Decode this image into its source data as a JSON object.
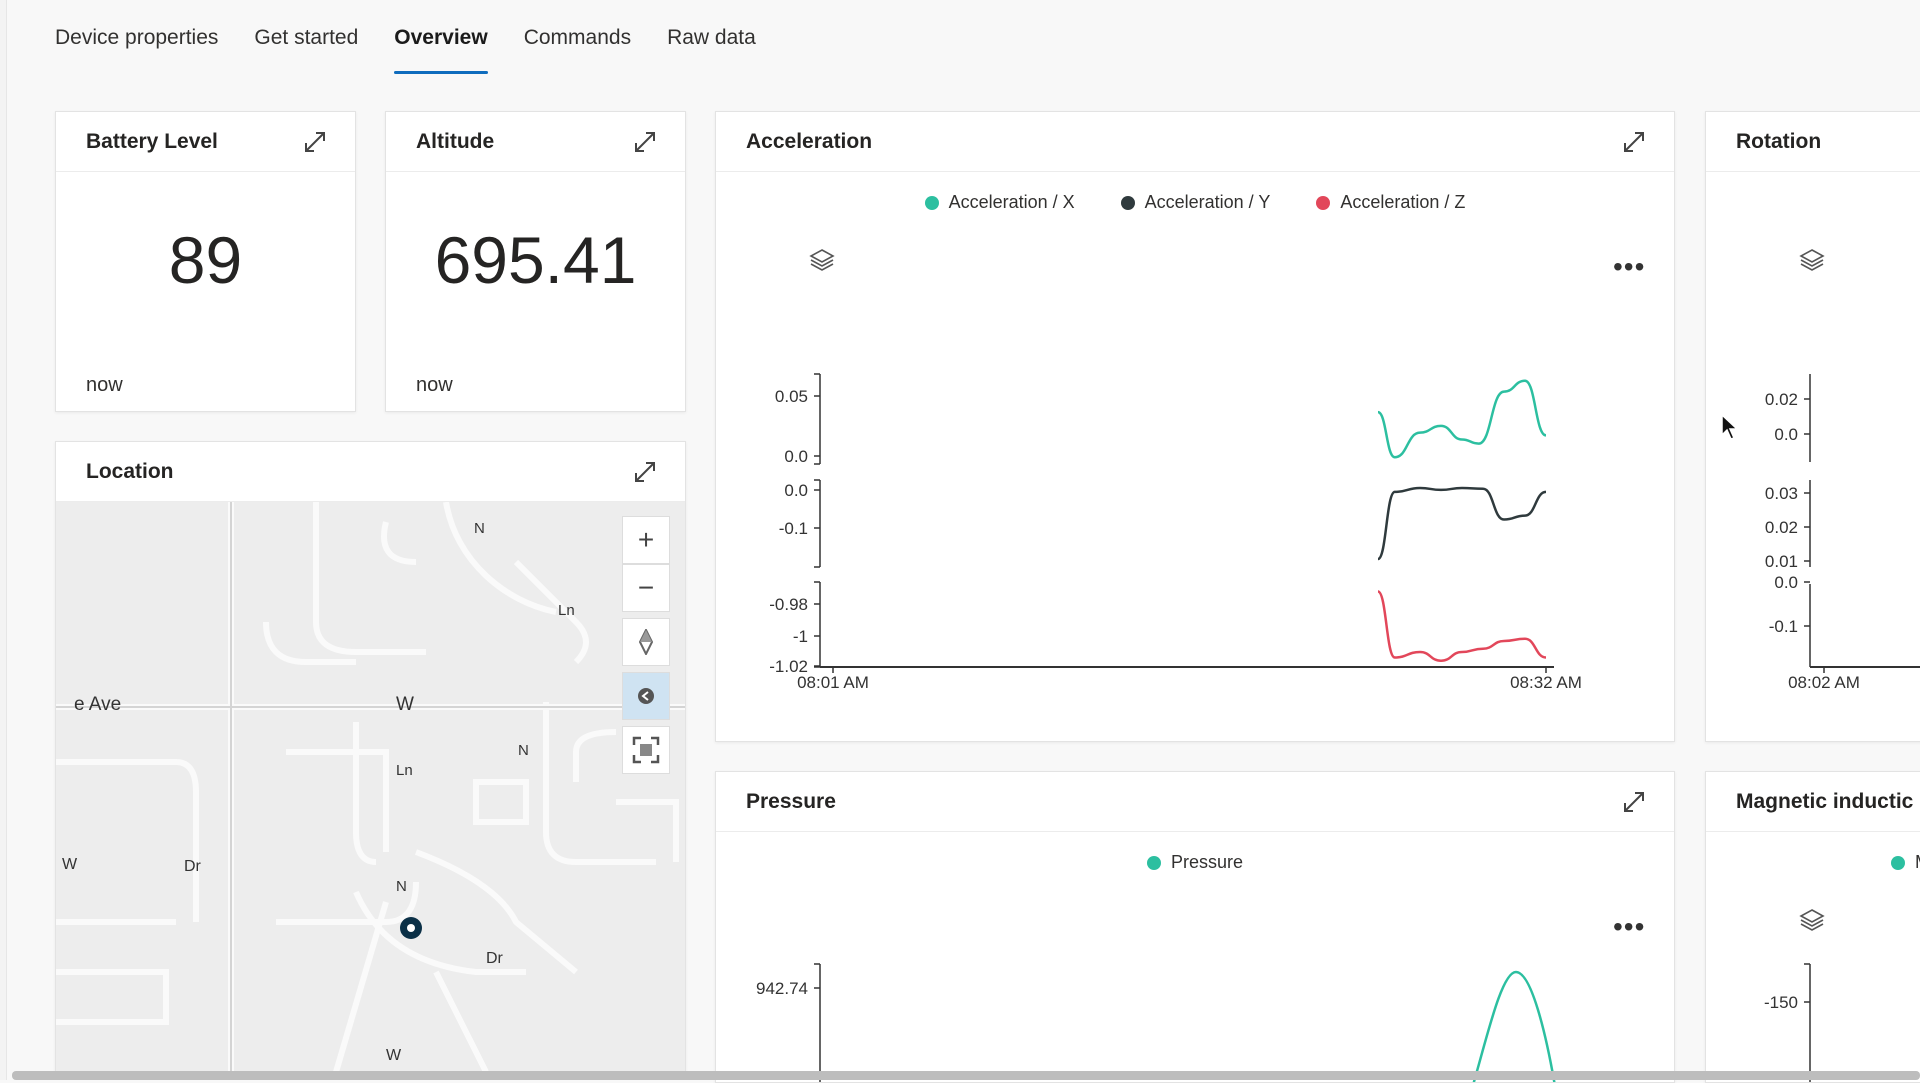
{
  "tabs": [
    {
      "label": "Device properties"
    },
    {
      "label": "Get started"
    },
    {
      "label": "Overview"
    },
    {
      "label": "Commands"
    },
    {
      "label": "Raw data"
    }
  ],
  "active_tab": "Overview",
  "battery": {
    "title": "Battery Level",
    "value": "89",
    "time": "now"
  },
  "altitude": {
    "title": "Altitude",
    "value": "695.41",
    "time": "now"
  },
  "location": {
    "title": "Location",
    "labels": {
      "ave": "e Ave",
      "w_road": "W",
      "w_dr": "W",
      "dr_left": "Dr",
      "dr_bottom": "Dr",
      "w_bottom": "W",
      "n1": "N",
      "n2": "N",
      "n3": "N",
      "ln": "Ln",
      "ln2": "Ln"
    },
    "controls": {
      "zoom_in": "+",
      "zoom_out": "−"
    }
  },
  "acceleration": {
    "title": "Acceleration",
    "legend": [
      {
        "name": "Acceleration / X",
        "color": "#2cbfa0"
      },
      {
        "name": "Acceleration / Y",
        "color": "#2f3a3d"
      },
      {
        "name": "Acceleration / Z",
        "color": "#e2475a"
      }
    ],
    "more": "•••"
  },
  "rotation": {
    "title": "Rotation"
  },
  "pressure": {
    "title": "Pressure",
    "legend": [
      {
        "name": "Pressure",
        "color": "#2cbfa0"
      }
    ],
    "more": "•••"
  },
  "magnetic": {
    "title": "Magnetic inductic",
    "legend_partial": "M"
  },
  "chart_data": [
    {
      "type": "line",
      "title": "Acceleration",
      "x_ticks": [
        "08:01 AM",
        "08:32 AM"
      ],
      "panels": [
        {
          "series": "Acceleration / X",
          "color": "#2cbfa0",
          "y_ticks": [
            "0.05",
            "0.0"
          ],
          "ylim": [
            0.0,
            0.06
          ],
          "x": [
            0,
            0.2,
            0.5,
            0.75,
            1.0,
            1.2,
            1.5,
            1.75,
            2.0
          ],
          "y": [
            0.035,
            0.002,
            0.02,
            0.025,
            0.015,
            0.012,
            0.05,
            0.058,
            0.018
          ]
        },
        {
          "series": "Acceleration / Y",
          "color": "#2f3a3d",
          "y_ticks": [
            "0.0",
            "-0.1"
          ],
          "ylim": [
            -0.18,
            0.02
          ],
          "x": [
            0,
            0.2,
            0.5,
            0.75,
            1.0,
            1.25,
            1.5,
            1.75,
            2.0
          ],
          "y": [
            -0.17,
            0.0,
            0.01,
            0.005,
            0.01,
            0.008,
            -0.07,
            -0.06,
            0.0
          ]
        },
        {
          "series": "Acceleration / Z",
          "color": "#e2475a",
          "y_ticks": [
            "-0.98",
            "-1",
            "-1.02"
          ],
          "ylim": [
            -1.02,
            -0.95
          ],
          "x": [
            0,
            0.2,
            0.5,
            0.75,
            1.0,
            1.25,
            1.5,
            1.75,
            2.0
          ],
          "y": [
            -0.955,
            -1.015,
            -1.01,
            -1.018,
            -1.01,
            -1.007,
            -1.0,
            -0.998,
            -1.015
          ]
        }
      ]
    },
    {
      "type": "line",
      "title": "Rotation",
      "x_ticks": [
        "08:02 AM"
      ],
      "panels": [
        {
          "y_ticks": [
            "0.02",
            "0.0"
          ]
        },
        {
          "y_ticks": [
            "0.03",
            "0.02",
            "0.01"
          ]
        },
        {
          "y_ticks": [
            "0.0",
            "-0.1"
          ]
        }
      ]
    },
    {
      "type": "line",
      "title": "Pressure",
      "series": [
        {
          "name": "Pressure",
          "color": "#2cbfa0"
        }
      ],
      "y_ticks": [
        "942.74"
      ]
    },
    {
      "type": "line",
      "title": "Magnetic inductic",
      "y_ticks": [
        "-150"
      ]
    }
  ]
}
